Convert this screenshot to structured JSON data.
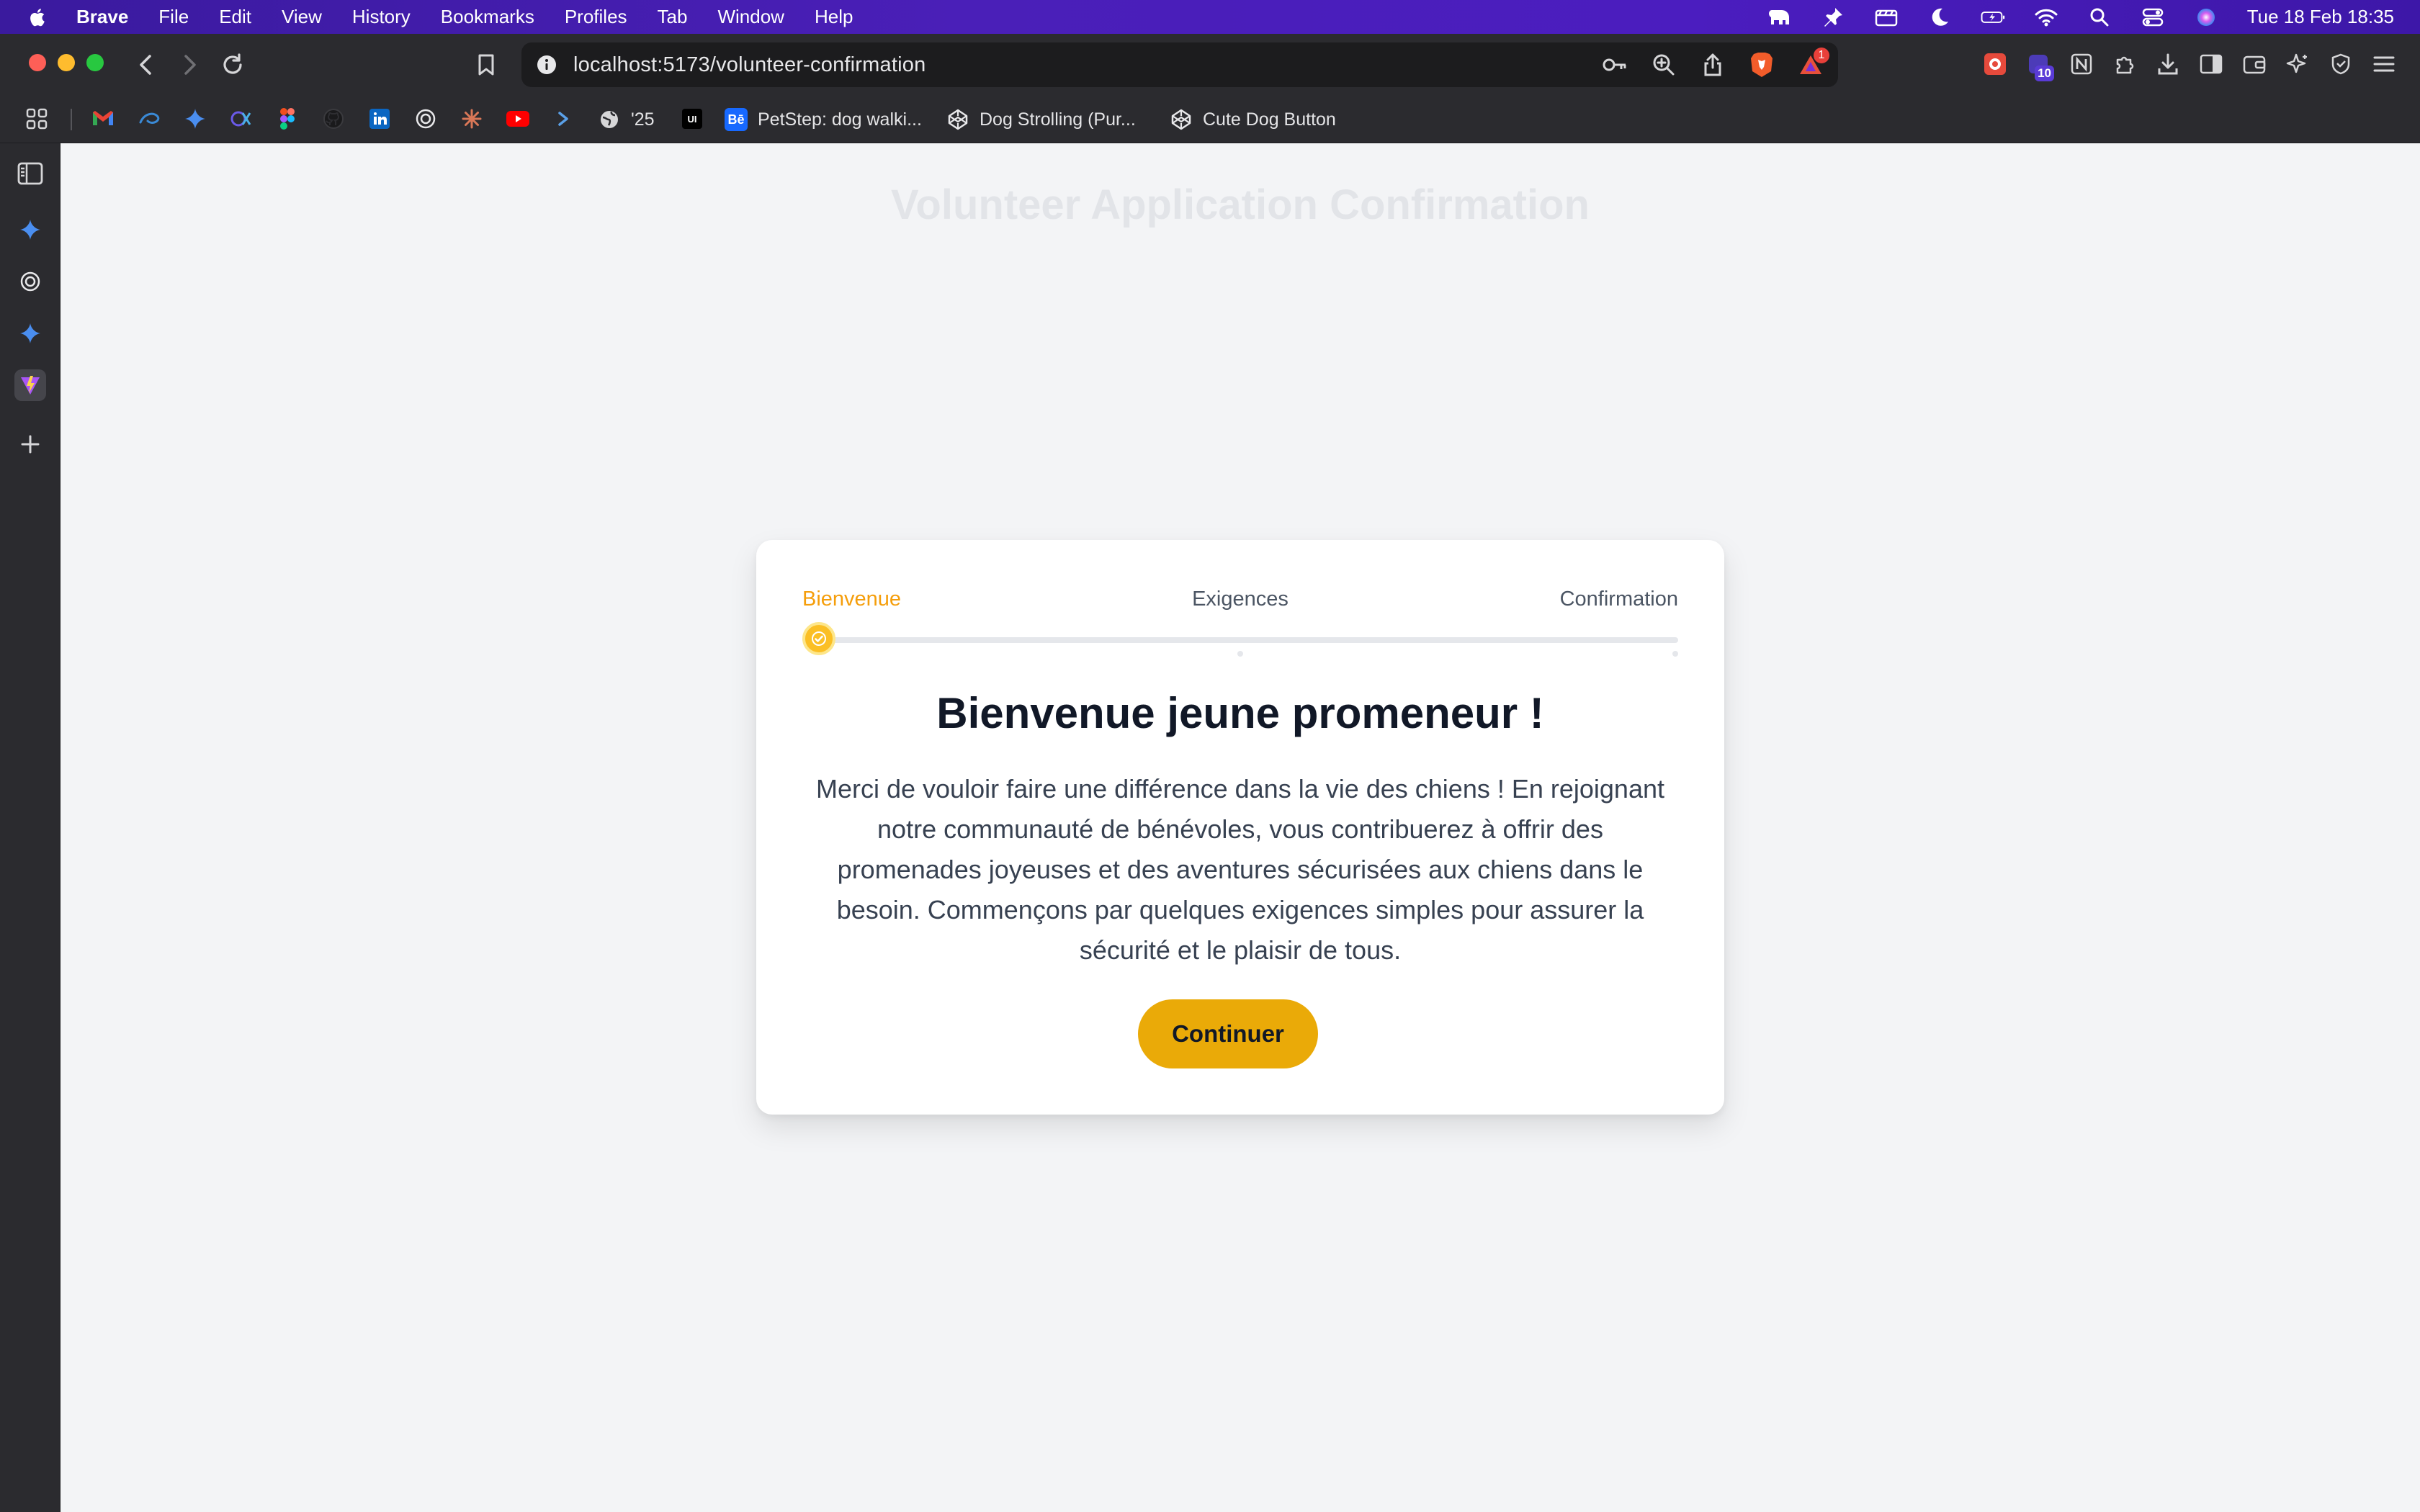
{
  "menubar": {
    "app_name": "Brave",
    "items": [
      "File",
      "Edit",
      "View",
      "History",
      "Bookmarks",
      "Profiles",
      "Tab",
      "Window",
      "Help"
    ],
    "clock": "Tue 18 Feb  18:35"
  },
  "browser": {
    "url": "localhost:5173/volunteer-confirmation",
    "shields_badge": "1",
    "extension_badge": "10"
  },
  "bookmarks": {
    "year_label": "'25",
    "links": [
      {
        "label": "PetStep: dog walki...",
        "fav": "Bē"
      },
      {
        "label": "Dog Strolling (Pur..."
      },
      {
        "label": "Cute Dog Button"
      }
    ]
  },
  "page": {
    "title": "Volunteer Application Confirmation"
  },
  "stepper": {
    "steps": [
      "Bienvenue",
      "Exigences",
      "Confirmation"
    ],
    "current_step": 1,
    "progress": 0
  },
  "card": {
    "heading": "Bienvenue jeune promeneur !",
    "text": "Merci de vouloir faire une différence dans la vie des chiens ! En rejoignant notre communauté de bénévoles, vous contribuerez à offrir des promenades joyeuses et des aventures sécurisées aux chiens dans le besoin. Commençons par quelques exigences simples pour assurer la sécurité et le plaisir de tous.",
    "button_label": "Continuer"
  },
  "colors": {
    "accent": "#f59e0b",
    "button": "#eaaa08",
    "menubar": "#4a1fb8",
    "chrome": "#2b2b2f"
  }
}
